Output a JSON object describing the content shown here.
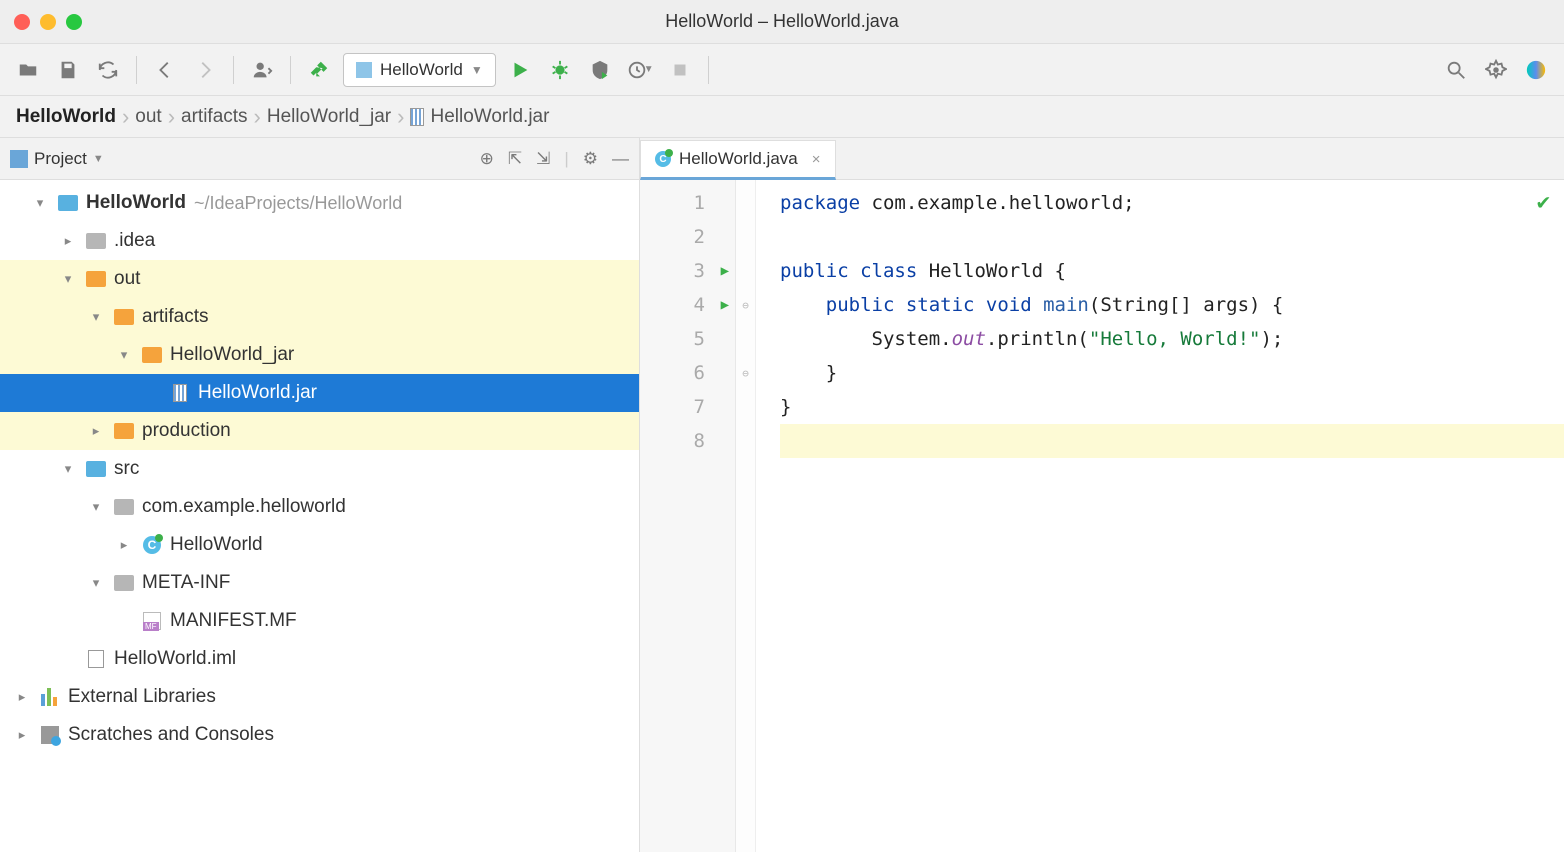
{
  "window": {
    "title": "HelloWorld – HelloWorld.java"
  },
  "toolbar": {
    "run_config": "HelloWorld"
  },
  "breadcrumb": [
    "HelloWorld",
    "out",
    "artifacts",
    "HelloWorld_jar",
    "HelloWorld.jar"
  ],
  "tool_window": {
    "title": "Project"
  },
  "tree": {
    "root": {
      "name": "HelloWorld",
      "path": "~/IdeaProjects/HelloWorld"
    },
    "idea": ".idea",
    "out": "out",
    "artifacts": "artifacts",
    "hw_jar_folder": "HelloWorld_jar",
    "hw_jar_file": "HelloWorld.jar",
    "production": "production",
    "src": "src",
    "pkg": "com.example.helloworld",
    "cls": "HelloWorld",
    "metainf": "META-INF",
    "manifest": "MANIFEST.MF",
    "iml": "HelloWorld.iml",
    "ext_lib": "External Libraries",
    "scratches": "Scratches and Consoles"
  },
  "editor": {
    "tab": "HelloWorld.java",
    "lines": {
      "l1_package": "package ",
      "l1_pkg": "com.example.helloworld;",
      "l3_public": "public ",
      "l3_class": "class ",
      "l3_name": "HelloWorld {",
      "l4_psv": "    public static ",
      "l4_void": "void ",
      "l4_main": "main",
      "l4_args": "(String[] args) {",
      "l5_sys": "        System.",
      "l5_out": "out",
      "l5_pr": ".println(",
      "l5_str": "\"Hello, World!\"",
      "l5_end": ");",
      "l6": "    }",
      "l7": "}"
    },
    "gutters": [
      1,
      2,
      3,
      4,
      5,
      6,
      7,
      8
    ]
  }
}
